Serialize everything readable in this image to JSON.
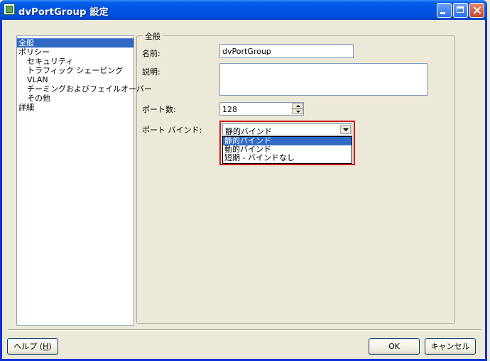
{
  "window": {
    "title": "dvPortGroup 設定",
    "icon": "vmware-dvportgroup-icon",
    "controls": [
      "minimize",
      "maximize",
      "close"
    ]
  },
  "tree": {
    "items": [
      {
        "label": "全般",
        "selected": true,
        "indent": 0
      },
      {
        "label": "ポリシー",
        "selected": false,
        "indent": 0
      },
      {
        "label": "セキュリティ",
        "selected": false,
        "indent": 1
      },
      {
        "label": "トラフィック シェーピング",
        "selected": false,
        "indent": 1
      },
      {
        "label": "VLAN",
        "selected": false,
        "indent": 1
      },
      {
        "label": "チーミングおよびフェイルオーバー",
        "selected": false,
        "indent": 1
      },
      {
        "label": "その他",
        "selected": false,
        "indent": 1
      },
      {
        "label": "詳細",
        "selected": false,
        "indent": 0
      }
    ]
  },
  "general": {
    "group_title": "全般",
    "name_label": "名前:",
    "name_value": "dvPortGroup",
    "desc_label": "説明:",
    "desc_value": "",
    "ports_label": "ポート数:",
    "ports_value": "128",
    "binding_label": "ポート バインド:",
    "binding_value": "静的バインド",
    "binding_options": [
      "静的バインド",
      "動的バインド",
      "短期 - バインドなし"
    ],
    "binding_highlighted": 0
  },
  "footer": {
    "help_label": "ヘルプ (",
    "help_accel": "H",
    "help_suffix": ")",
    "ok_label": "OK",
    "cancel_label": "キャンセル"
  },
  "colors": {
    "titlebar": "#0055e5",
    "selection": "#316ac5",
    "highlight_border": "#d11a1a",
    "dialog_bg": "#ece9d8"
  }
}
